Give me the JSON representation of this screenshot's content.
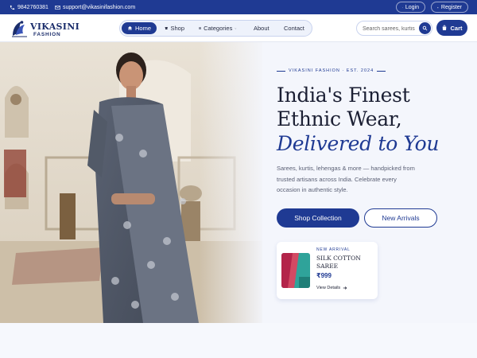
{
  "topbar": {
    "phone": "9842760381",
    "email": "support@vikasinifashion.com",
    "login_label": "Login",
    "register_label": "Register"
  },
  "brand": {
    "name": "VIKASINI",
    "sub": "FASHION",
    "primary_color": "#1f3a93"
  },
  "nav": {
    "items": [
      {
        "label": "Home",
        "icon": "home-icon",
        "active": true
      },
      {
        "label": "Shop",
        "icon": "store-icon"
      },
      {
        "label": "Categories",
        "icon": "grid-icon",
        "dropdown": true
      },
      {
        "label": "About"
      },
      {
        "label": "Contact"
      }
    ]
  },
  "search": {
    "placeholder": "Search sarees, kurtis"
  },
  "cart": {
    "label": "Cart"
  },
  "hero": {
    "eyebrow": "VIKASINI FASHION · EST. 2024",
    "headline_1": "India's Finest",
    "headline_2": "Ethnic Wear,",
    "headline_3": "Delivered to You",
    "description": "Sarees, kurtis, lehengas & more — handpicked from trusted artisans across India. Celebrate every occasion in authentic style.",
    "primary_cta": "Shop Collection",
    "secondary_cta": "New Arrivals"
  },
  "featured": {
    "tag": "NEW ARRIVAL",
    "title": "SILK COTTON SAREE",
    "price": "₹999",
    "link": "View Details"
  }
}
